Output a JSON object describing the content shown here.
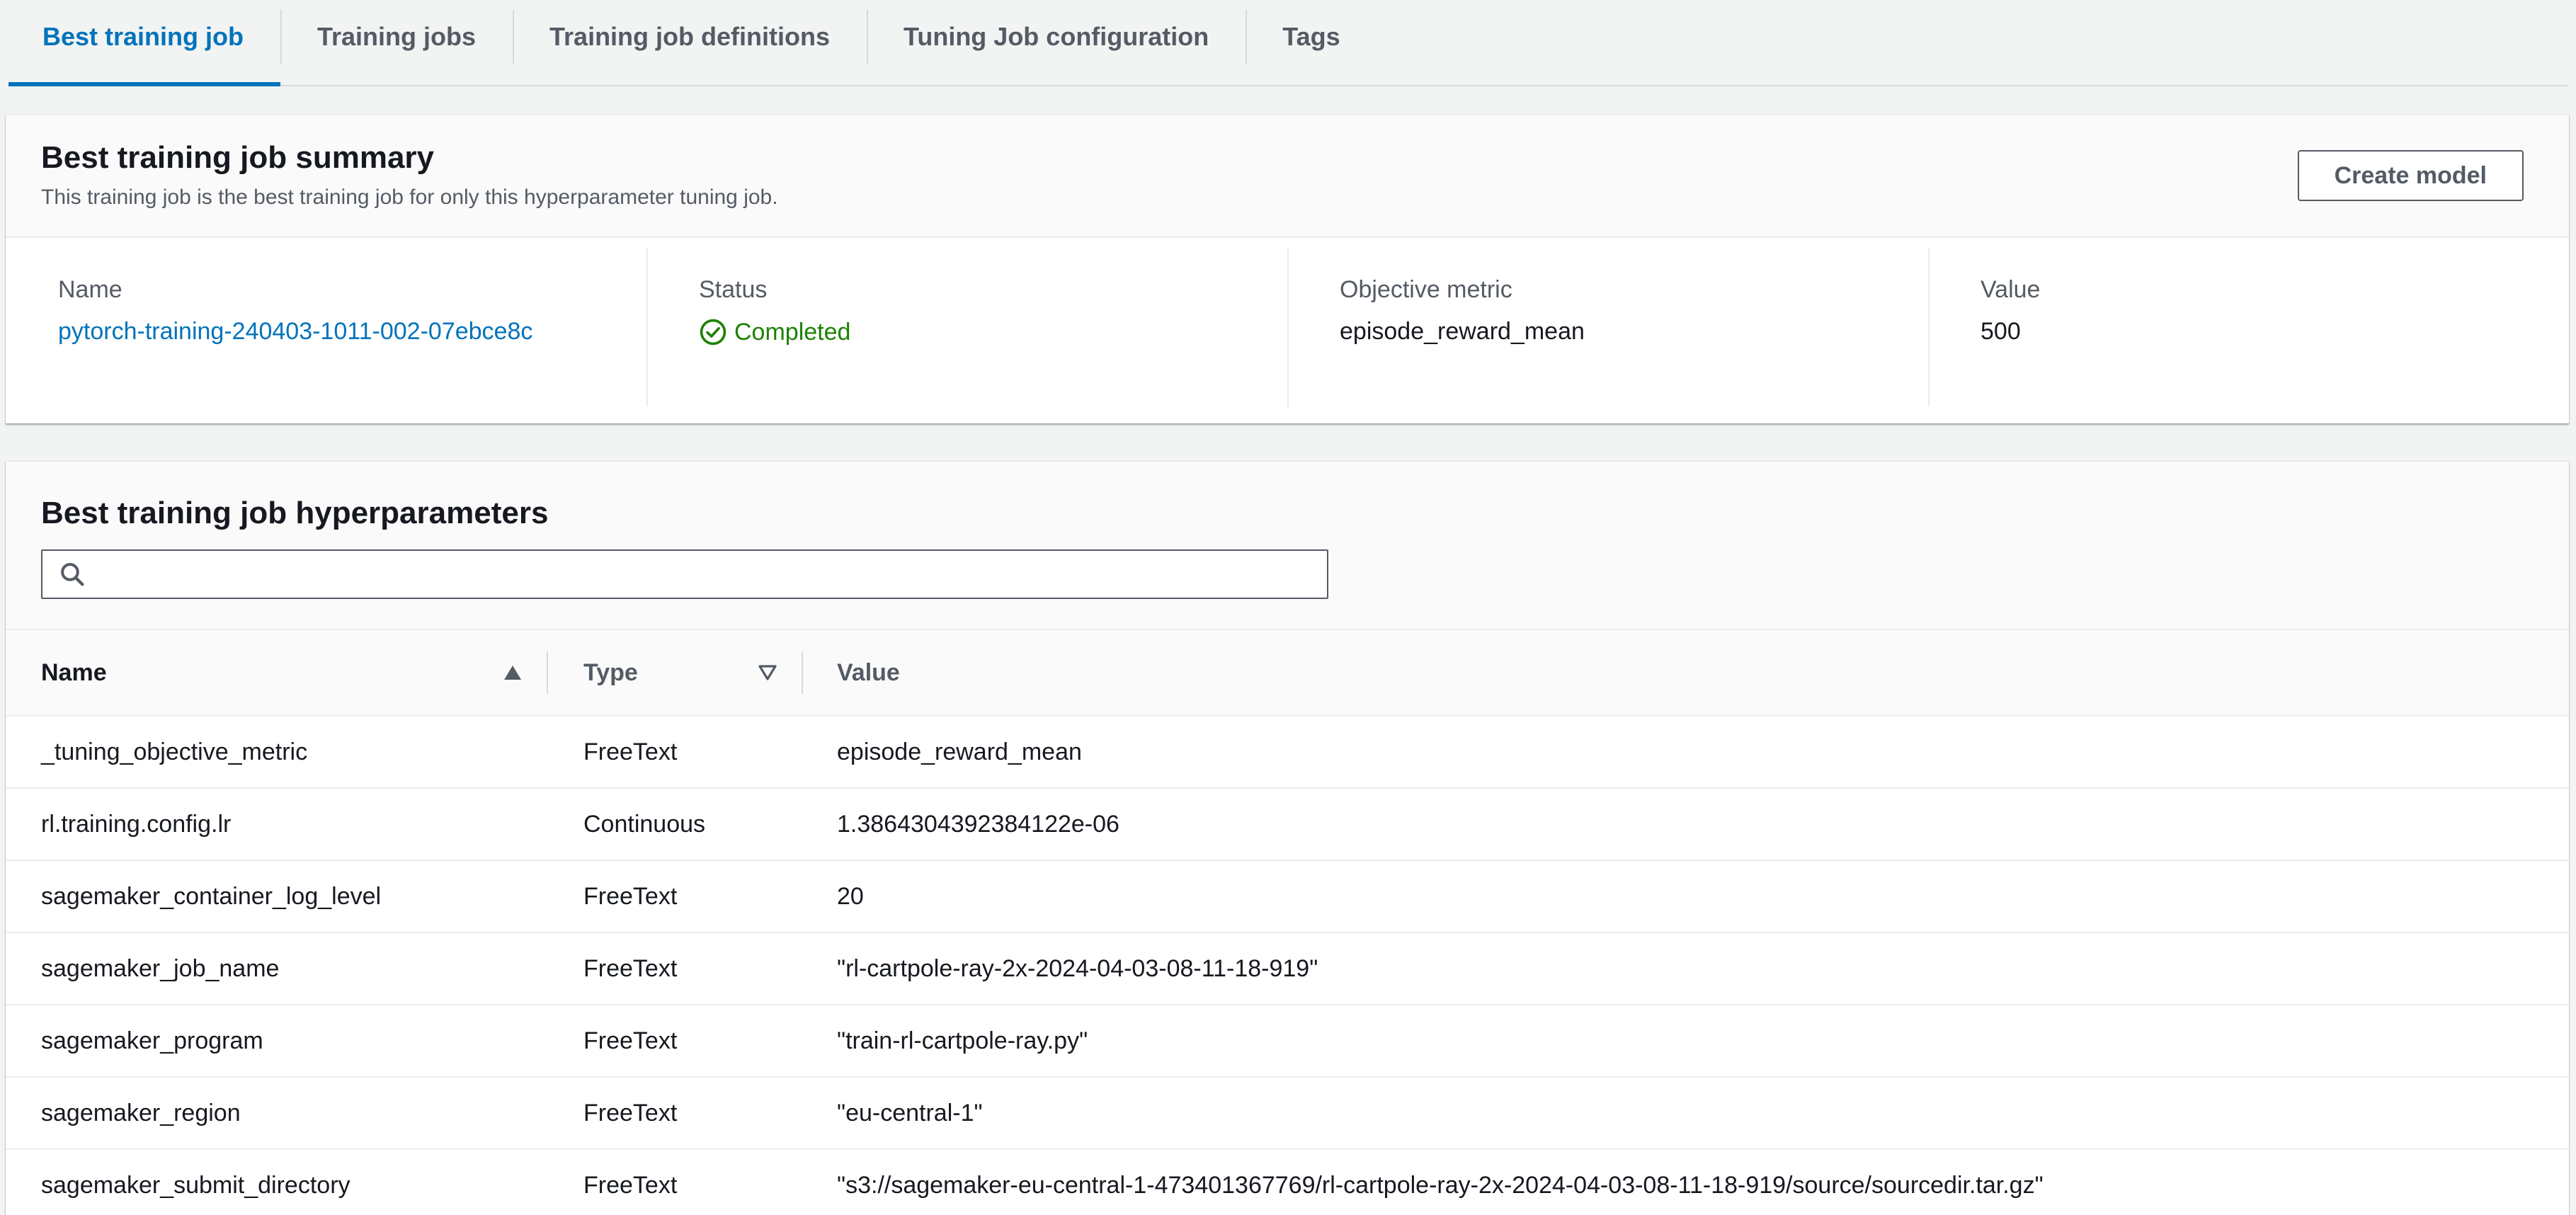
{
  "tabs": [
    {
      "label": "Best training job",
      "active": true
    },
    {
      "label": "Training jobs",
      "active": false
    },
    {
      "label": "Training job definitions",
      "active": false
    },
    {
      "label": "Tuning Job configuration",
      "active": false
    },
    {
      "label": "Tags",
      "active": false
    }
  ],
  "summary": {
    "title": "Best training job summary",
    "description": "This training job is the best training job for only this hyperparameter tuning job.",
    "create_model_label": "Create model",
    "name_label": "Name",
    "name_value": "pytorch-training-240403-1011-002-07ebce8c",
    "status_label": "Status",
    "status_value": "Completed",
    "status_icon": "check-circle-icon",
    "objective_label": "Objective metric",
    "objective_value": "episode_reward_mean",
    "value_label": "Value",
    "value_value": "500"
  },
  "hyperparameters": {
    "title": "Best training job hyperparameters",
    "search_placeholder": "",
    "search_icon": "search-icon",
    "columns": {
      "name": "Name",
      "type": "Type",
      "value": "Value"
    },
    "rows": [
      {
        "name": "_tuning_objective_metric",
        "type": "FreeText",
        "value": "episode_reward_mean"
      },
      {
        "name": "rl.training.config.lr",
        "type": "Continuous",
        "value": "1.3864304392384122e-06"
      },
      {
        "name": "sagemaker_container_log_level",
        "type": "FreeText",
        "value": "20"
      },
      {
        "name": "sagemaker_job_name",
        "type": "FreeText",
        "value": "\"rl-cartpole-ray-2x-2024-04-03-08-11-18-919\""
      },
      {
        "name": "sagemaker_program",
        "type": "FreeText",
        "value": "\"train-rl-cartpole-ray.py\""
      },
      {
        "name": "sagemaker_region",
        "type": "FreeText",
        "value": "\"eu-central-1\""
      },
      {
        "name": "sagemaker_submit_directory",
        "type": "FreeText",
        "value": "\"s3://sagemaker-eu-central-1-473401367769/rl-cartpole-ray-2x-2024-04-03-08-11-18-919/source/sourcedir.tar.gz\""
      }
    ]
  },
  "colors": {
    "link": "#0073bb",
    "success": "#1d8102",
    "text": "#16191f",
    "muted": "#545b64"
  }
}
